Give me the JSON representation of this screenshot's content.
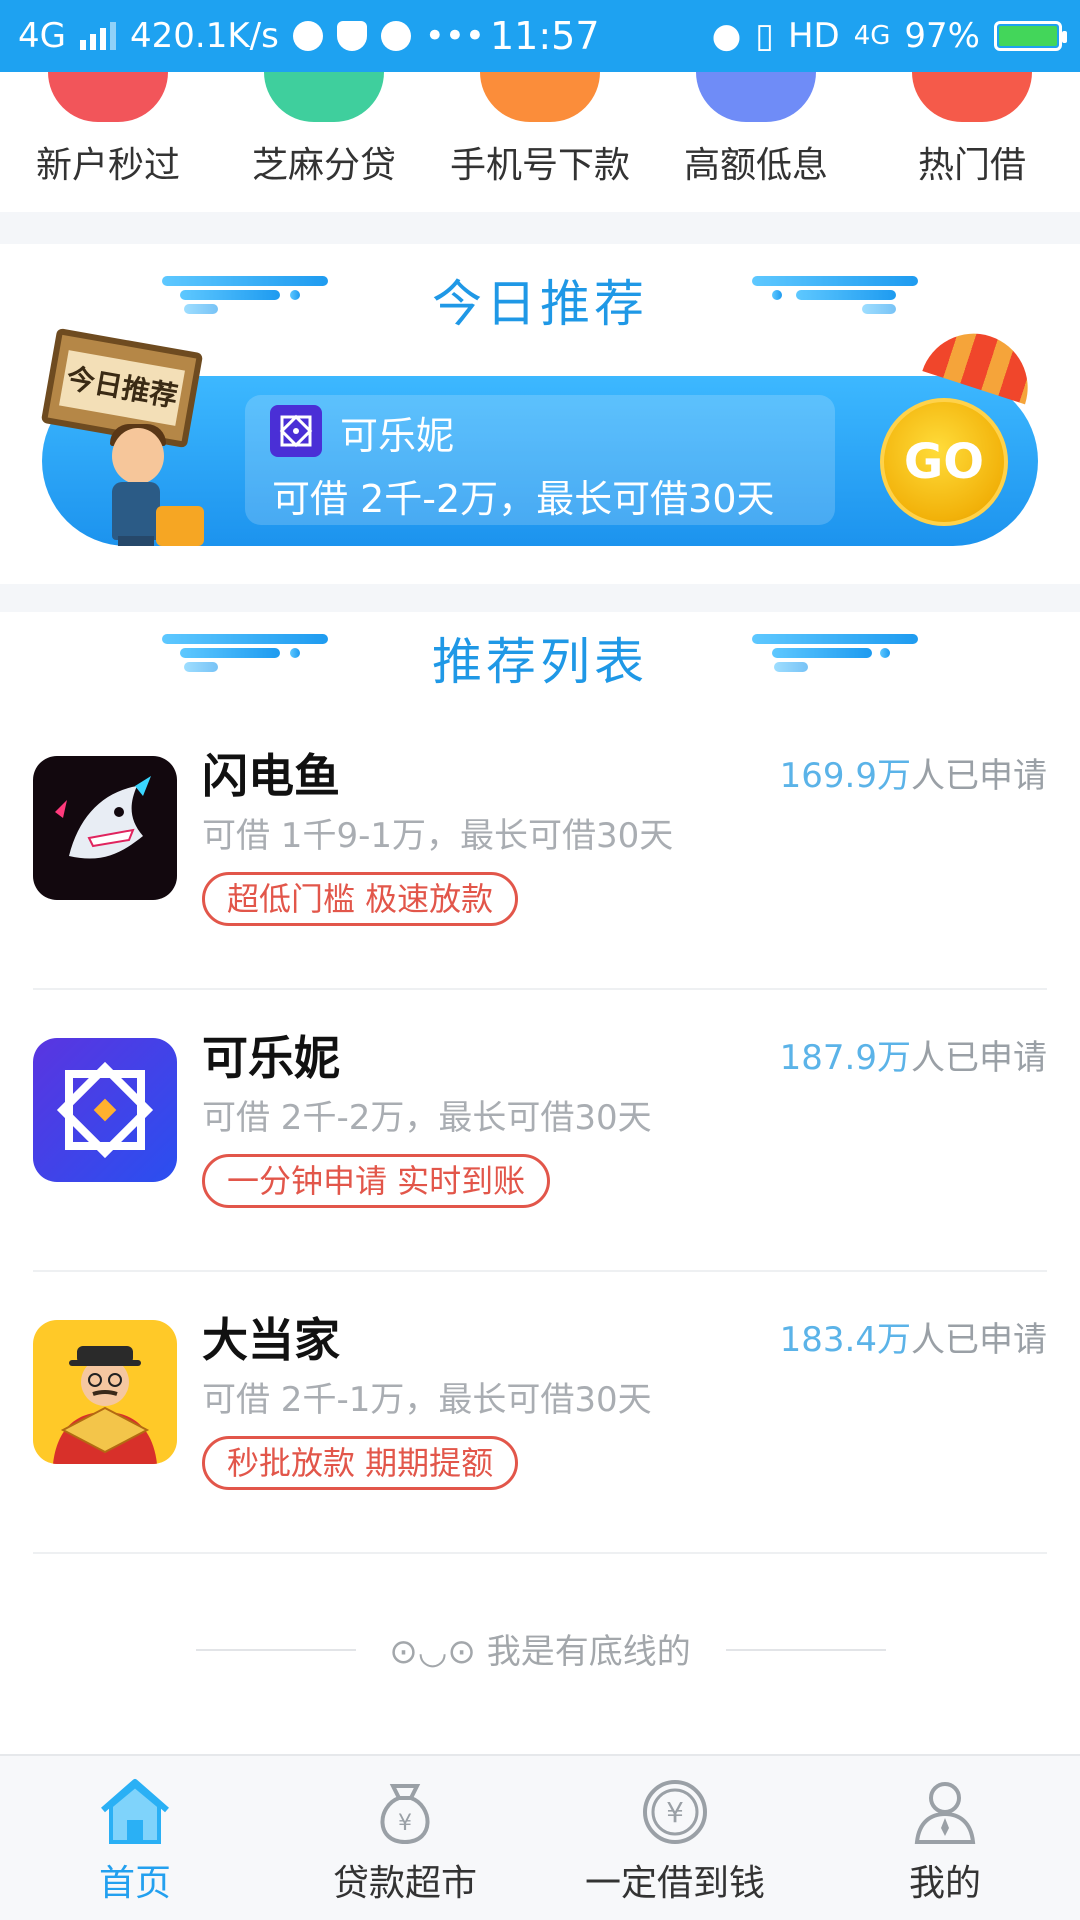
{
  "status_bar": {
    "network": "4G",
    "speed": "420.1K/s",
    "time": "11:57",
    "hd": "HD",
    "net_type": "4G",
    "battery": "97%"
  },
  "categories": [
    {
      "label": "新户秒过",
      "color": "#f2555a"
    },
    {
      "label": "芝麻分贷",
      "color": "#3fcf9d"
    },
    {
      "label": "手机号下款",
      "color": "#fb8d3a"
    },
    {
      "label": "高额低息",
      "color": "#6f8cf7"
    },
    {
      "label": "热门借",
      "color": "#f55a4a"
    }
  ],
  "today": {
    "title": "今日推荐",
    "sign_text": "今日推荐",
    "product_name": "可乐妮",
    "product_desc": "可借 2千-2万，最长可借30天",
    "go_label": "GO"
  },
  "list": {
    "title": "推荐列表",
    "items": [
      {
        "name": "闪电鱼",
        "count": "169.9万",
        "count_suffix": "人已申请",
        "desc": "可借 1千9-1万，最长可借30天",
        "tag": "超低门槛 极速放款",
        "icon": "shark-icon"
      },
      {
        "name": "可乐妮",
        "count": "187.9万",
        "count_suffix": "人已申请",
        "desc": "可借 2千-2万，最长可借30天",
        "tag": "一分钟申请 实时到账",
        "icon": "flower-pattern-icon"
      },
      {
        "name": "大当家",
        "count": "183.4万",
        "count_suffix": "人已申请",
        "desc": "可借 2千-1万，最长可借30天",
        "tag": "秒批放款 期期提额",
        "icon": "boss-character-icon"
      }
    ],
    "footer": "⊙◡⊙ 我是有底线的"
  },
  "tabs": [
    {
      "label": "首页",
      "icon": "home-icon",
      "active": true
    },
    {
      "label": "贷款超市",
      "icon": "money-bag-icon",
      "active": false
    },
    {
      "label": "一定借到钱",
      "icon": "yuan-coin-icon",
      "active": false
    },
    {
      "label": "我的",
      "icon": "person-icon",
      "active": false
    }
  ]
}
